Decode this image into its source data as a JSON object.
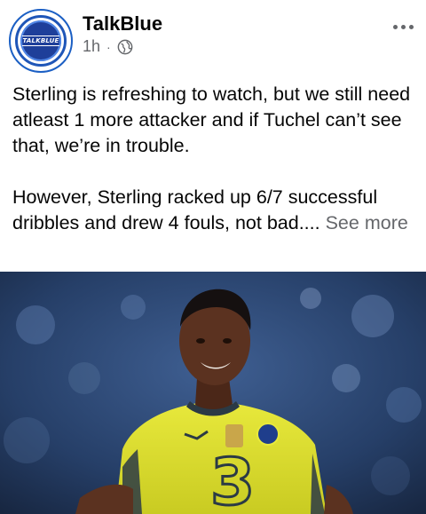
{
  "post": {
    "page_name": "TalkBlue",
    "avatar_text": "TALKBLUE",
    "time": "1h",
    "separator": "·",
    "privacy_icon": "globe-icon",
    "more_icon": "more-horizontal-icon",
    "paragraph1": "Sterling is refreshing to watch, but we still need atleast 1 more attacker and if Tuchel can’t see that, we’re in trouble.",
    "paragraph2_text": "However, Sterling racked up 6/7 successful dribbles and drew 4 fouls, not bad....",
    "see_more": "See more"
  },
  "photo": {
    "jersey_sponsor": "3",
    "colors": {
      "jersey": "#e4e534",
      "jersey_trim": "#2b3a45",
      "crowd": "#2c4a7a",
      "skin": "#5b3220"
    }
  },
  "colors": {
    "accent": "#1e3f9a",
    "text": "#050505",
    "muted": "#65676b"
  }
}
